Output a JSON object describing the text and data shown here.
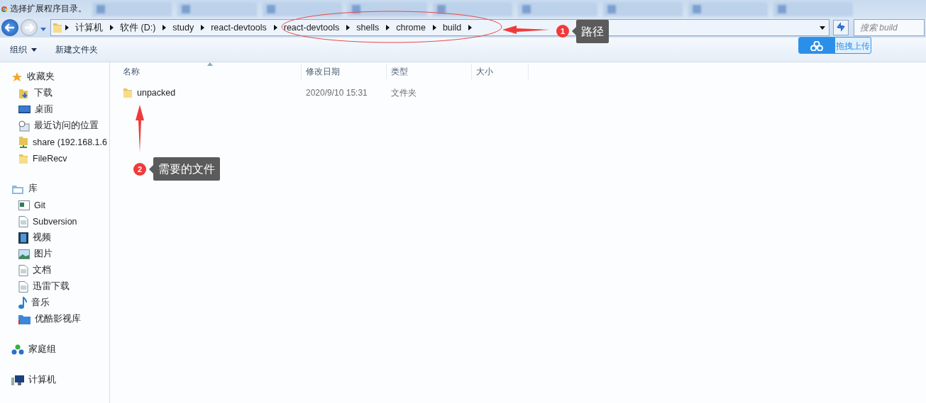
{
  "window": {
    "title": "选择扩展程序目录。"
  },
  "browser_tabs": [
    {
      "kind": "tab"
    },
    {
      "kind": "tab"
    },
    {
      "kind": "tab"
    },
    {
      "kind": "tab"
    },
    {
      "kind": "tab"
    },
    {
      "kind": "tab"
    },
    {
      "kind": "tab"
    },
    {
      "kind": "tab"
    },
    {
      "kind": "tab"
    }
  ],
  "address_bar": {
    "crumbs": [
      "计算机",
      "软件 (D:)",
      "study",
      "react-devtools",
      "react-devtools",
      "shells",
      "chrome",
      "build"
    ]
  },
  "search": {
    "placeholder": "搜索 build"
  },
  "upload_button": "拖拽上传",
  "toolbar": [
    {
      "label": "组织",
      "kind": "menu"
    },
    {
      "label": "新建文件夹",
      "kind": "plain"
    }
  ],
  "sidebar": {
    "groups": [
      {
        "label": "收藏夹",
        "kind": "star",
        "children": [
          {
            "label": "下载",
            "kind": "download"
          },
          {
            "label": "桌面",
            "kind": "desktop"
          },
          {
            "label": "最近访问的位置",
            "kind": "recent"
          },
          {
            "label": "share (192.168.1.6",
            "kind": "share"
          },
          {
            "label": "FileRecv",
            "kind": "folder"
          }
        ]
      },
      {
        "label": "库",
        "kind": "library",
        "children": [
          {
            "label": "Git",
            "kind": "window"
          },
          {
            "label": "Subversion",
            "kind": "doc"
          },
          {
            "label": "视频",
            "kind": "video"
          },
          {
            "label": "图片",
            "kind": "image"
          },
          {
            "label": "文档",
            "kind": "doc"
          },
          {
            "label": "迅雷下载",
            "kind": "doc"
          },
          {
            "label": "音乐",
            "kind": "music"
          },
          {
            "label": "优酷影视库",
            "kind": "libfolder"
          }
        ]
      },
      {
        "label": "家庭组",
        "kind": "homegroup"
      },
      {
        "label": "计算机",
        "kind": "computer"
      }
    ]
  },
  "table": {
    "columns": [
      "名称",
      "修改日期",
      "类型",
      "大小"
    ],
    "rows": [
      {
        "name": "unpacked",
        "modified": "2020/9/10 15:31",
        "type": "文件夹"
      }
    ]
  },
  "annotations": [
    {
      "number": "1",
      "label": "路径"
    },
    {
      "number": "2",
      "label": "需要的文件"
    }
  ]
}
